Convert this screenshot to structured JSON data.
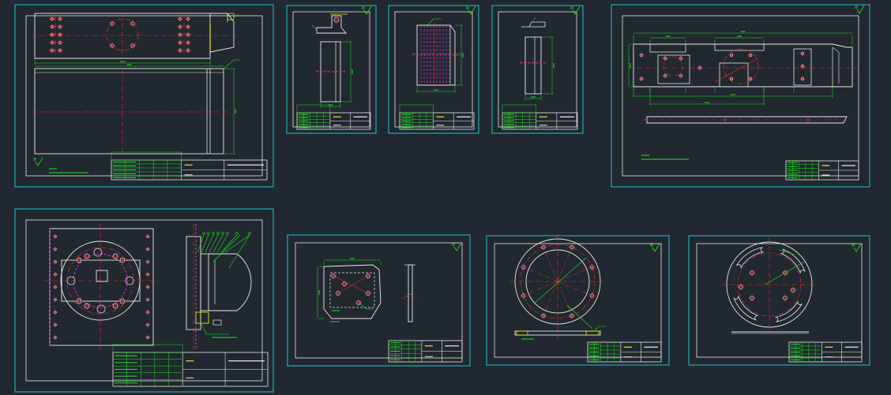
{
  "colors": {
    "background": "#212830",
    "sheet_frame": "#18c8cc",
    "drawing_line": "#e9e9e9",
    "centerline": "#ff2b2b",
    "dimension": "#21e621",
    "hidden_line": "#d13cd1",
    "label_yellow": "#e8e81a",
    "title_block": "#1fe01f"
  },
  "sheets": [
    {
      "id": "s1",
      "title": "",
      "code": "",
      "kind": "plate-assembly",
      "has_bom": true
    },
    {
      "id": "s2",
      "title": "",
      "code": "",
      "kind": "bracket",
      "has_bom": true
    },
    {
      "id": "s3",
      "title": "",
      "code": "",
      "kind": "plate-hidden",
      "has_bom": true
    },
    {
      "id": "s4",
      "title": "",
      "code": "",
      "kind": "bar",
      "has_bom": true
    },
    {
      "id": "s5",
      "title": "",
      "code": "",
      "kind": "long-arm",
      "has_bom": false
    },
    {
      "id": "s6",
      "title": "",
      "code": "",
      "kind": "turntable-assembly",
      "has_bom": true
    },
    {
      "id": "s7",
      "title": "",
      "code": "",
      "kind": "mount-plate",
      "has_bom": false
    },
    {
      "id": "s8",
      "title": "",
      "code": "",
      "kind": "flange-ring",
      "has_bom": false
    },
    {
      "id": "s9",
      "title": "",
      "code": "",
      "kind": "slotted-disc",
      "has_bom": false
    }
  ],
  "icons": {
    "roughness_symbol": "surface-roughness-icon"
  }
}
